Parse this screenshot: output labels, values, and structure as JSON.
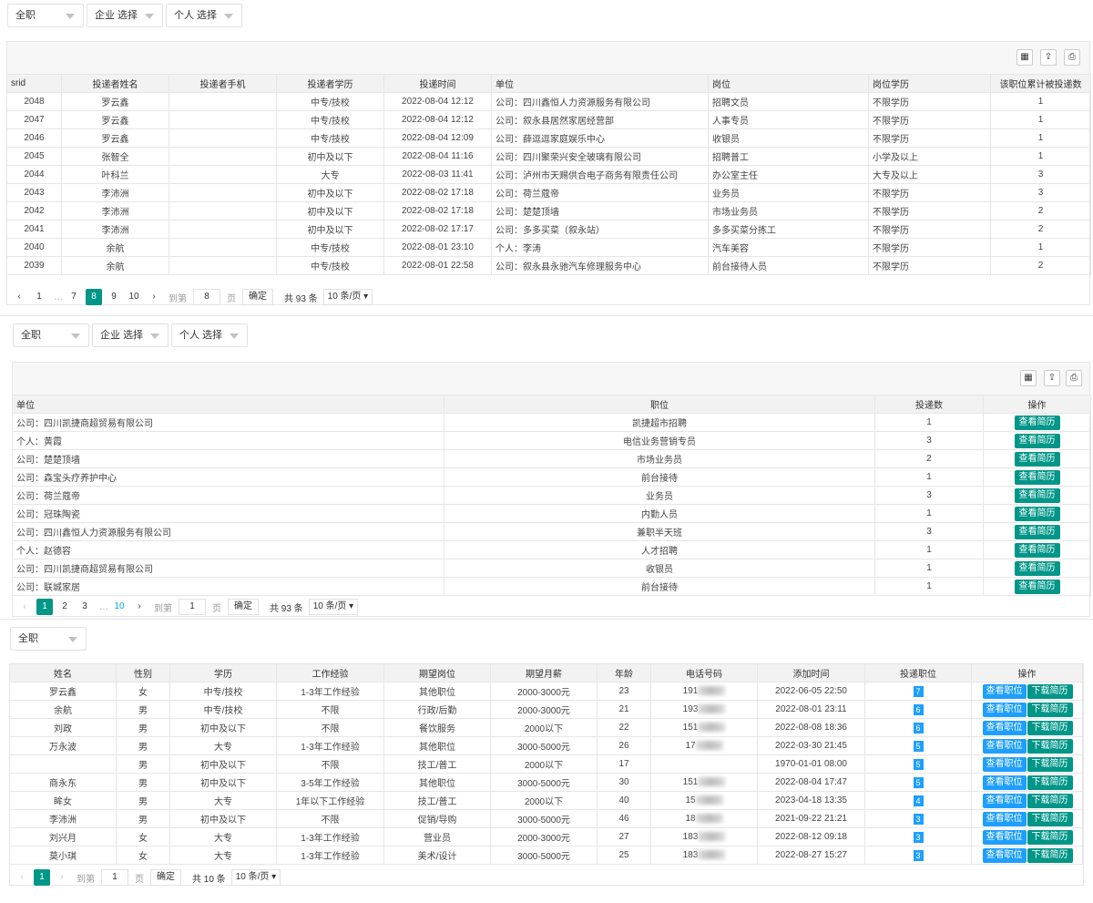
{
  "filters1": {
    "job": "全职",
    "company": "企业 选择",
    "person": "个人 选择"
  },
  "table1": {
    "headers": [
      "srid",
      "投递者姓名",
      "投递者手机",
      "投递者学历",
      "投递时间",
      "单位",
      "岗位",
      "岗位学历",
      "该职位累计被投递数"
    ],
    "rows": [
      [
        "2048",
        "罗云鑫",
        "",
        "中专/技校",
        "2022-08-04 12:12",
        "公司：四川鑫恒人力资源服务有限公司",
        "招聘文员",
        "不限学历",
        "1"
      ],
      [
        "2047",
        "罗云鑫",
        "",
        "中专/技校",
        "2022-08-04 12:12",
        "公司：叙永县居然家居经营部",
        "人事专员",
        "不限学历",
        "1"
      ],
      [
        "2046",
        "罗云鑫",
        "",
        "中专/技校",
        "2022-08-04 12:09",
        "公司：薛逗逗家庭娱乐中心",
        "收银员",
        "不限学历",
        "1"
      ],
      [
        "2045",
        "张智全",
        "",
        "初中及以下",
        "2022-08-04 11:16",
        "公司：四川聚荣兴安全玻璃有限公司",
        "招聘普工",
        "小学及以上",
        "1"
      ],
      [
        "2044",
        "叶科兰",
        "",
        "大专",
        "2022-08-03 11:41",
        "公司：泸州市天赐供合电子商务有限责任公司",
        "办公室主任",
        "大专及以上",
        "3"
      ],
      [
        "2043",
        "李沛洲",
        "",
        "初中及以下",
        "2022-08-02 17:18",
        "公司：荷兰蔻帝",
        "业务员",
        "不限学历",
        "3"
      ],
      [
        "2042",
        "李沛洲",
        "",
        "初中及以下",
        "2022-08-02 17:18",
        "公司：楚楚顶墙",
        "市场业务员",
        "不限学历",
        "2"
      ],
      [
        "2041",
        "李沛洲",
        "",
        "初中及以下",
        "2022-08-02 17:17",
        "公司：多多买菜（叙永站）",
        "多多买菜分拣工",
        "不限学历",
        "2"
      ],
      [
        "2040",
        "余航",
        "",
        "中专/技校",
        "2022-08-01 23:10",
        "个人：李涛",
        "汽车美容",
        "不限学历",
        "1"
      ],
      [
        "2039",
        "余航",
        "",
        "中专/技校",
        "2022-08-01 22:58",
        "公司：叙永县永驰汽车修理服务中心",
        "前台接待人员",
        "不限学历",
        "2"
      ]
    ]
  },
  "pager1": {
    "first": "1",
    "ellipsis": "…",
    "p7": "7",
    "current": "8",
    "p9": "9",
    "p10": "10",
    "goto": "到第",
    "goto_value": "8",
    "page_unit": "页",
    "ok": "确定",
    "total": "共 93 条",
    "limit": "10 条/页"
  },
  "filters2": {
    "job": "全职",
    "company": "企业 选择",
    "person": "个人 选择"
  },
  "table2": {
    "headers": [
      "单位",
      "职位",
      "投递数",
      "操作"
    ],
    "action_label": "查看简历",
    "rows": [
      [
        "公司：四川凯捷商超贸易有限公司",
        "凯捷超市招聘",
        "1"
      ],
      [
        "个人：黄霞",
        "电信业务营销专员",
        "3"
      ],
      [
        "公司：楚楚顶墙",
        "市场业务员",
        "2"
      ],
      [
        "公司：森宝头疗养护中心",
        "前台接待",
        "1"
      ],
      [
        "公司：荷兰蔻帝",
        "业务员",
        "3"
      ],
      [
        "公司：冠珠陶瓷",
        "内勤人员",
        "1"
      ],
      [
        "公司：四川鑫恒人力资源服务有限公司",
        "兼职半天班",
        "3"
      ],
      [
        "个人：赵德容",
        "人才招聘",
        "1"
      ],
      [
        "公司：四川凯捷商超贸易有限公司",
        "收银员",
        "1"
      ],
      [
        "公司：联城家居",
        "前台接待",
        "1"
      ]
    ]
  },
  "pager2": {
    "current": "1",
    "p2": "2",
    "p3": "3",
    "ellipsis": "…",
    "last": "10",
    "goto": "到第",
    "goto_value": "1",
    "page_unit": "页",
    "ok": "确定",
    "total": "共 93 条",
    "limit": "10 条/页"
  },
  "filters3": {
    "job": "全职"
  },
  "table3": {
    "headers": [
      "姓名",
      "性别",
      "学历",
      "工作经验",
      "期望岗位",
      "期望月薪",
      "年龄",
      "电话号码",
      "添加时间",
      "投递职位",
      "操作"
    ],
    "view_label": "查看职位",
    "download_label": "下载简历",
    "rows": [
      [
        "罗云鑫",
        "女",
        "中专/技校",
        "1-3年工作经验",
        "其他职位",
        "2000-3000元",
        "23",
        "191",
        "2022-06-05 22:50",
        "7"
      ],
      [
        "余航",
        "男",
        "中专/技校",
        "不限",
        "行政/后勤",
        "2000-3000元",
        "21",
        "193",
        "2022-08-01 23:11",
        "6"
      ],
      [
        "刘政",
        "男",
        "初中及以下",
        "不限",
        "餐饮服务",
        "2000以下",
        "22",
        "151",
        "2022-08-08 18:36",
        "6"
      ],
      [
        "万永波",
        "男",
        "大专",
        "1-3年工作经验",
        "其他职位",
        "3000-5000元",
        "26",
        "17",
        "2022-03-30 21:45",
        "5"
      ],
      [
        "",
        "男",
        "初中及以下",
        "不限",
        "技工/普工",
        "2000以下",
        "17",
        "",
        "1970-01-01 08:00",
        "5"
      ],
      [
        "商永东",
        "男",
        "初中及以下",
        "3-5年工作经验",
        "其他职位",
        "3000-5000元",
        "30",
        "151",
        "2022-08-04 17:47",
        "5"
      ],
      [
        "眸女",
        "男",
        "大专",
        "1年以下工作经验",
        "技工/普工",
        "2000以下",
        "40",
        "15",
        "2023-04-18 13:35",
        "4"
      ],
      [
        "李沛洲",
        "男",
        "初中及以下",
        "不限",
        "促销/导购",
        "3000-5000元",
        "46",
        "18",
        "2021-09-22 21:21",
        "3"
      ],
      [
        "刘兴月",
        "女",
        "大专",
        "1-3年工作经验",
        "营业员",
        "2000-3000元",
        "27",
        "183",
        "2022-08-12 09:18",
        "3"
      ],
      [
        "莫小琪",
        "女",
        "大专",
        "1-3年工作经验",
        "美术/设计",
        "3000-5000元",
        "25",
        "183",
        "2022-08-27 15:27",
        "3"
      ]
    ]
  },
  "pager3": {
    "current": "1",
    "goto": "到第",
    "goto_value": "1",
    "page_unit": "页",
    "ok": "确定",
    "total": "共 10 条",
    "limit": "10 条/页"
  }
}
